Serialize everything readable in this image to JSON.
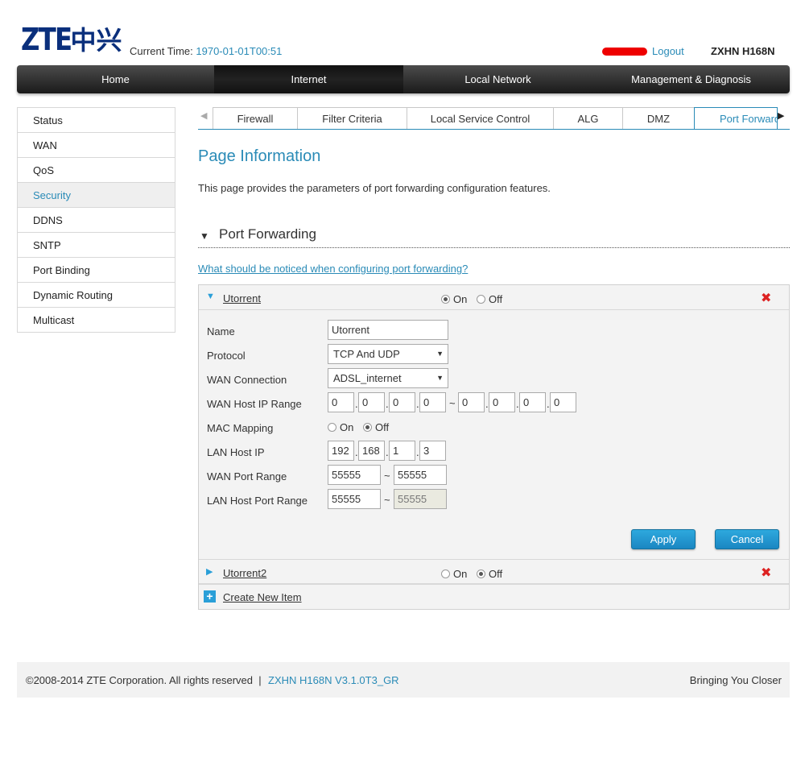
{
  "header": {
    "logo_text": "ZTE",
    "logo_cn": "中兴",
    "current_time_label": "Current Time:",
    "current_time_value": "1970-01-01T00:51",
    "logout": "Logout",
    "model": "ZXHN H168N"
  },
  "nav": [
    "Home",
    "Internet",
    "Local Network",
    "Management & Diagnosis"
  ],
  "sidebar": [
    "Status",
    "WAN",
    "QoS",
    "Security",
    "DDNS",
    "SNTP",
    "Port Binding",
    "Dynamic Routing",
    "Multicast"
  ],
  "subtabs": [
    "Firewall",
    "Filter Criteria",
    "Local Service Control",
    "ALG",
    "DMZ",
    "Port Forwarding"
  ],
  "page": {
    "title": "Page Information",
    "description": "This page provides the parameters of port forwarding configuration features.",
    "section_title": "Port Forwarding",
    "help_link": "What should be noticed when configuring port forwarding?"
  },
  "rules": [
    {
      "name": "Utorrent",
      "on_label": "On",
      "off_label": "Off",
      "state": "on"
    },
    {
      "name": "Utorrent2",
      "on_label": "On",
      "off_label": "Off",
      "state": "off"
    }
  ],
  "form": {
    "name_label": "Name",
    "name_value": "Utorrent",
    "protocol_label": "Protocol",
    "protocol_value": "TCP And UDP",
    "wan_conn_label": "WAN Connection",
    "wan_conn_value": "ADSL_internet",
    "wan_host_label": "WAN Host IP Range",
    "wan_ip_start": [
      "0",
      "0",
      "0",
      "0"
    ],
    "wan_ip_end": [
      "0",
      "0",
      "0",
      "0"
    ],
    "mac_label": "MAC Mapping",
    "mac_on": "On",
    "mac_off": "Off",
    "lan_ip_label": "LAN Host IP",
    "lan_ip": [
      "192",
      "168",
      "1",
      "3"
    ],
    "wan_port_label": "WAN Port Range",
    "wan_port_start": "55555",
    "wan_port_end": "55555",
    "lan_port_label": "LAN Host Port Range",
    "lan_port_start": "55555",
    "lan_port_end": "55555",
    "tilde": "~",
    "dot": ".",
    "apply": "Apply",
    "cancel": "Cancel"
  },
  "create_new": "Create New Item",
  "footer": {
    "copyright": "©2008-2014 ZTE Corporation. All rights reserved",
    "separator": "|",
    "version": "ZXHN H168N V3.1.0T3_GR",
    "slogan": "Bringing You Closer"
  },
  "colors": {
    "accent": "#2a8bb7",
    "button": "#2ea9de",
    "delete": "#dd2222"
  },
  "icons": {
    "expanded": "triangle-down-icon",
    "collapsed": "triangle-right-icon",
    "delete": "red-x-icon",
    "add": "plus-icon"
  }
}
